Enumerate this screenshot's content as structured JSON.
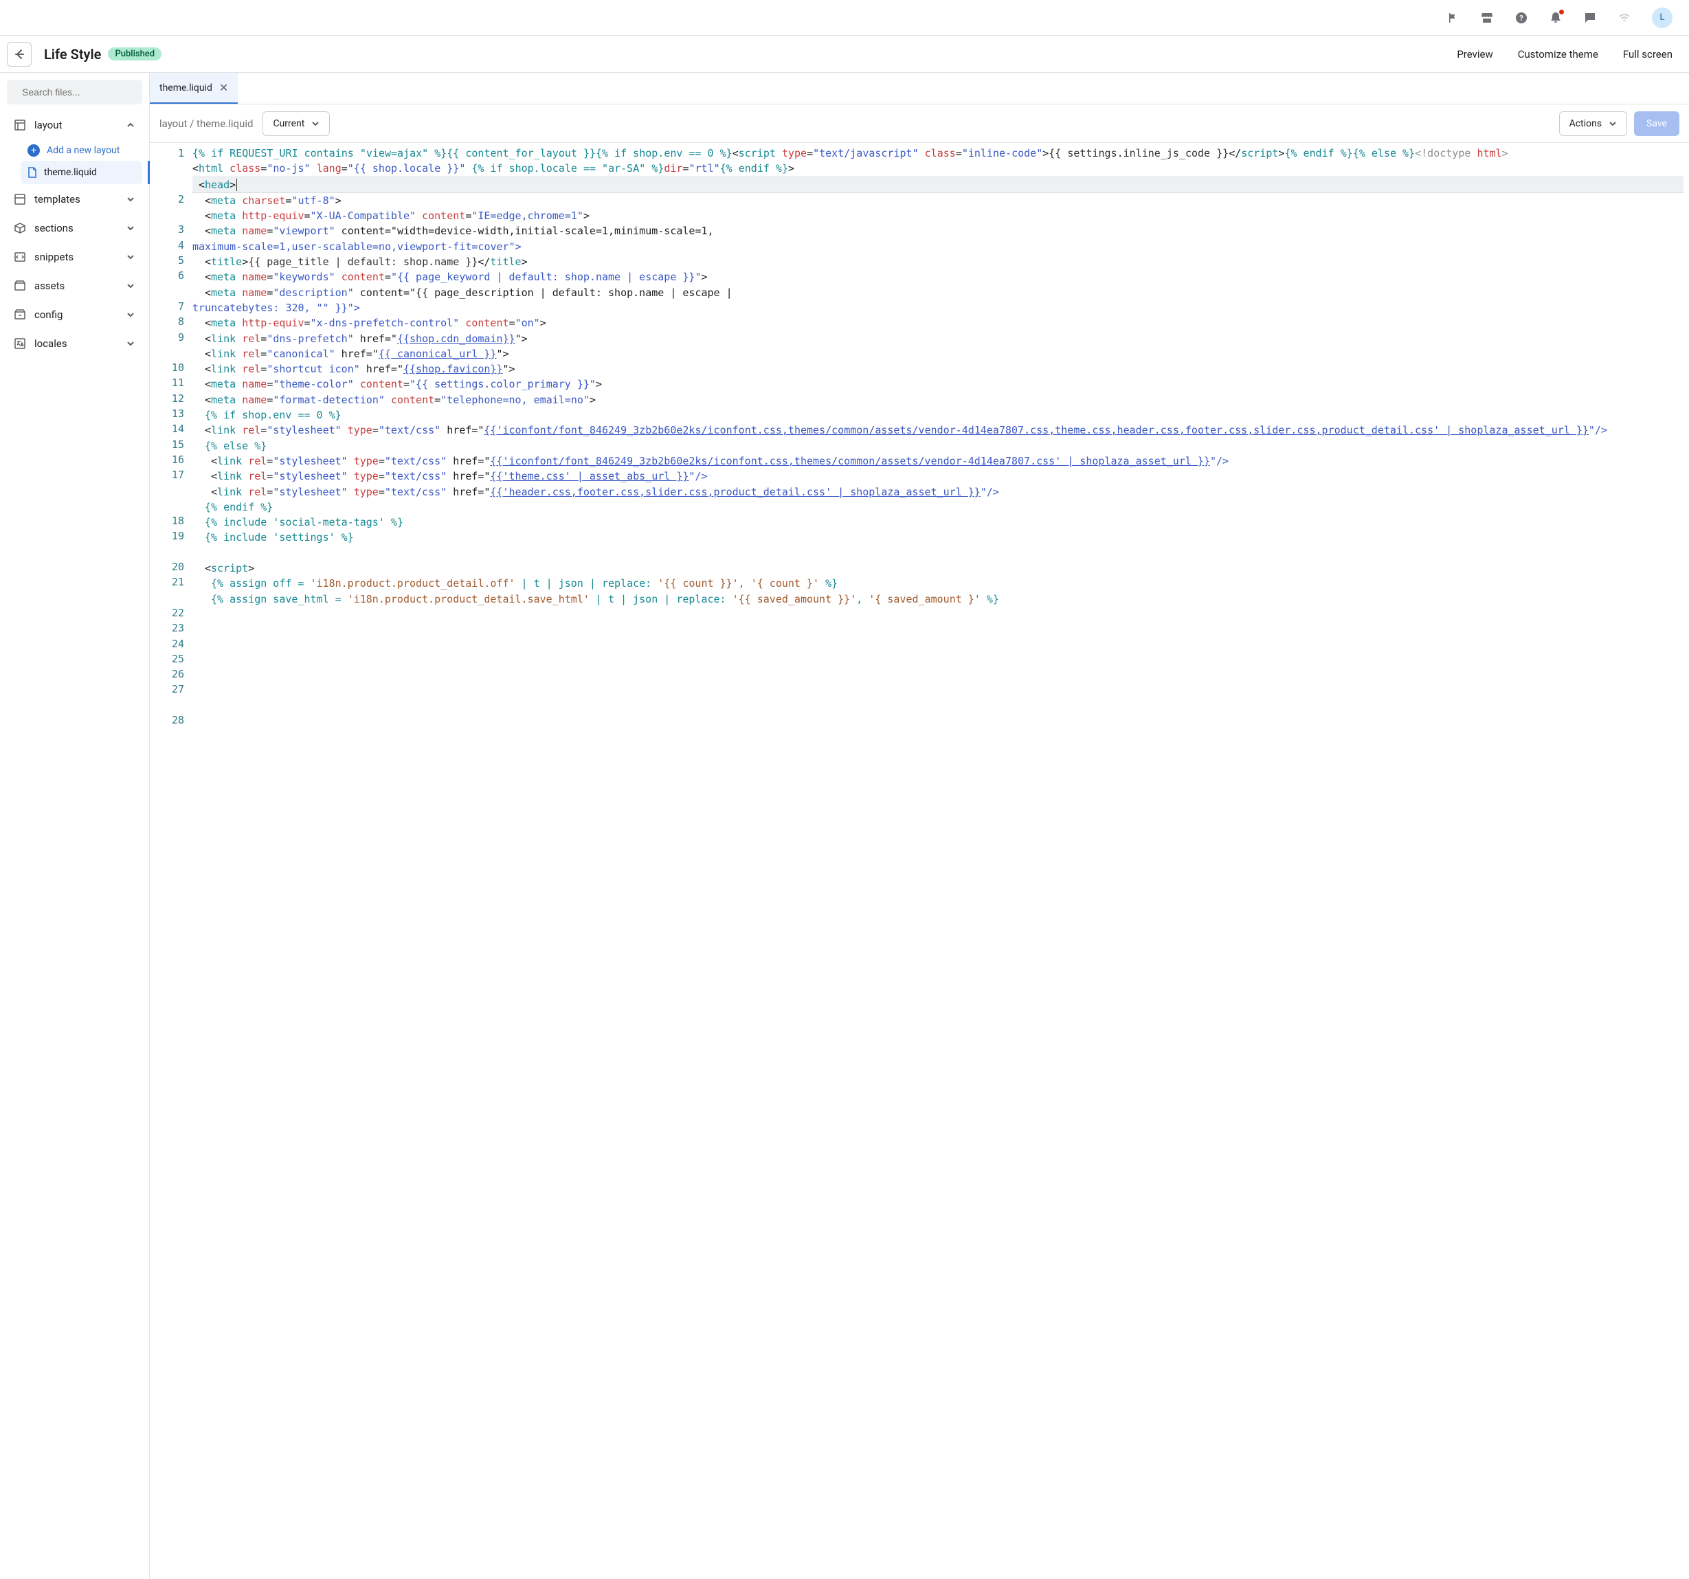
{
  "header": {
    "title": "Life Style",
    "badge": "Published",
    "links": {
      "preview": "Preview",
      "customize": "Customize theme",
      "fullscreen": "Full screen"
    },
    "avatar_initial": "L"
  },
  "sidebar": {
    "search_placeholder": "Search files...",
    "sections": {
      "layout": "layout",
      "templates": "templates",
      "sections_label": "sections",
      "snippets": "snippets",
      "assets": "assets",
      "config": "config",
      "locales": "locales"
    },
    "add_layout": "Add a new layout",
    "active_file": "theme.liquid"
  },
  "editor": {
    "tab_name": "theme.liquid",
    "breadcrumb": "layout / theme.liquid",
    "version_select": "Current",
    "actions_label": "Actions",
    "save_label": "Save"
  },
  "code": {
    "lines": [
      "1",
      "2",
      "3",
      "4",
      "5",
      "6",
      "7",
      "8",
      "9",
      "10",
      "11",
      "12",
      "13",
      "14",
      "15",
      "16",
      "17",
      "18",
      "19",
      "20",
      "21",
      "22",
      "23",
      "24",
      "25",
      "26",
      "27",
      "28"
    ],
    "l1a": "{% if REQUEST_URI contains \"view=ajax\" %}{{ content_for_layout }}{% if shop.env == 0 %}",
    "l1_open": "<",
    "l1_script": "script",
    "l1b_type": "type",
    "l1b_eq": "=",
    "l1b_tv": "\"text/javascript\"",
    "l1b_sp": " ",
    "l1b_class": "class",
    "l1b_cv": "\"inline-code\"",
    "l1b_gt": ">",
    "l1b_inner": "{{ settings.inline_js_code }}",
    "l1b_close": "</",
    "l1b_scriptc": "script",
    "l1b_closegt": ">",
    "l1b_endif": "{% endif %}{% else %}",
    "l1c_doct": "<!doctype ",
    "l1c_html": "html",
    "l1c_gt": ">",
    "l2_open": "<",
    "l2_html": "html",
    "l2_class": " class",
    "l2_classv": "\"no-js\"",
    "l2_lang": " lang",
    "l2_langv": "\"{{ shop.locale }}\"",
    "l2_if": " {% if shop.locale == \"ar-SA\" %}",
    "l2_dir": "dir",
    "l2_dirv": "\"rtl\"",
    "l2_endif": "{% endif %}",
    "l2_gt": ">",
    "l3": "<head>",
    "l4": "<meta charset=\"utf-8\">",
    "l5": "<meta http-equiv=\"X-UA-Compatible\" content=\"IE=edge,chrome=1\">",
    "l6a": "<meta name=\"viewport\" content=\"width=device-width,initial-scale=1,minimum-scale=1,",
    "l6b": "maximum-scale=1,user-scalable=no,viewport-fit=cover\">",
    "l7": "<title>{{ page_title | default: shop.name }}</title>",
    "l8": "<meta name=\"keywords\" content=\"{{ page_keyword | default: shop.name | escape }}\">",
    "l9a": "<meta name=\"description\" content=\"{{ page_description | default: shop.name | escape | ",
    "l9b": "truncatebytes: 320, \"\" }}\">",
    "l10": "<meta http-equiv=\"x-dns-prefetch-control\" content=\"on\">",
    "l11": "<link rel=\"dns-prefetch\" href=\"{{shop.cdn_domain}}\">",
    "l12": "<link rel=\"canonical\" href=\"{{ canonical_url }}\">",
    "l13": "<link rel=\"shortcut icon\" href=\"{{shop.favicon}}\">",
    "l14": "<meta name=\"theme-color\" content=\"{{ settings.color_primary }}\">",
    "l15": "<meta name=\"format-detection\" content=\"telephone=no, email=no\">",
    "l16": "{% if shop.env == 0 %}",
    "l17a": "<link rel=\"stylesheet\" type=\"text/css\" href=\"",
    "l17b": "{{'iconfont/font_846249_3zb2b60e2ks/iconfont.css,themes/common/assets/vendor-4d14ea7807.css,theme.css,header.css,footer.css,slider.css,product_detail.css' | shoplaza_asset_url }}",
    "l17c": "\"/>",
    "l18": "{% else %}",
    "l19a": "<link rel=\"stylesheet\" type=\"text/css\" href=\"",
    "l19b": "{{'iconfont/font_846249_3zb2b60e2ks/iconfont.css,themes/common/assets/vendor-4d14ea7807.css' | shoplaza_asset_url }}",
    "l19c": "\"/>",
    "l20a": "<link rel=\"stylesheet\" type=\"text/css\" href=\"",
    "l20b": "{{'theme.css' | asset_abs_url }}",
    "l20c": "\"/>",
    "l21a": "<link rel=\"stylesheet\" type=\"text/css\" href=\"",
    "l21b": "{{'header.css,footer.css,slider.css,product_detail.css' | shoplaza_asset_url }}",
    "l21c": "\"/>",
    "l22": "{% endif %}",
    "l23": "{% include 'social-meta-tags' %}",
    "l24": "{% include 'settings' %}",
    "l25": "",
    "l26": "<script>",
    "l27a": "{% assign off = ",
    "l27b": "'i18n.product.product_detail.off'",
    "l27c": " | t | json | replace: ",
    "l27d": "'{{ count }}'",
    "l27e": ", ",
    "l27f": "'{ count }'",
    "l27g": " %}",
    "l28a": "{% assign save_html = ",
    "l28b": "'i18n.product.product_detail.save_html'",
    "l28c": " | t | json | replace: ",
    "l28d": "'{{ saved_amount }}'",
    "l28e": ", ",
    "l28f": "'{ saved_amount }'",
    "l28g": " %}"
  }
}
